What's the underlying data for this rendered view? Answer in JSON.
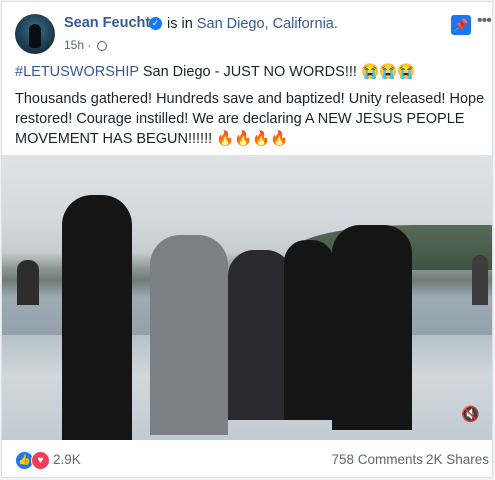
{
  "post": {
    "author": "Sean Feucht",
    "location_prefix": "is in",
    "location": "San Diego, California.",
    "time": "15h",
    "text": {
      "hashtag": "#LETUSWORSHIP",
      "line1_rest": " San Diego - JUST NO WORDS!!! 😭😭😭",
      "line2": "Thousands gathered! Hundreds save and baptized! Unity released! Hope restored! Courage instilled! We are declaring A NEW JESUS PEOPLE MOVEMENT HAS BEGUN!!!!!! 🔥🔥🔥🔥"
    }
  },
  "reactions": {
    "count": "2.9K",
    "comments": "758 Comments",
    "shares": "2K Shares"
  },
  "icons": {
    "verified": "verified-badge-icon",
    "privacy": "globe-icon",
    "pin": "pin-icon",
    "more": "more-icon",
    "like": "like-icon",
    "love": "love-icon",
    "volume": "volume-mute-icon"
  },
  "colors": {
    "link_blue": "#385898",
    "facebook_blue": "#1877f2",
    "love_red": "#f33e58"
  }
}
